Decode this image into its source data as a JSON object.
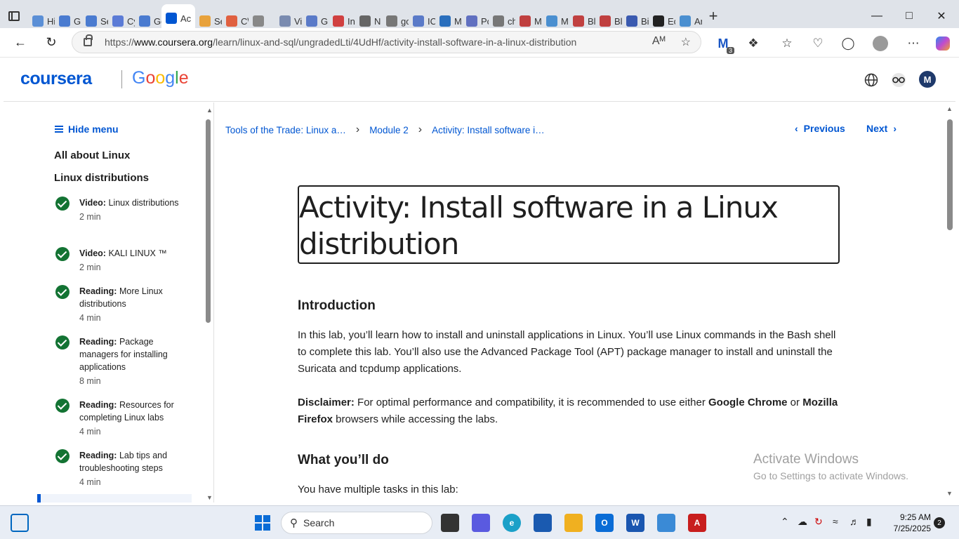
{
  "browser": {
    "tabs": [
      {
        "label": "Hi",
        "color": "#5b8fd6"
      },
      {
        "label": "G",
        "color": "#4a7bd0"
      },
      {
        "label": "Se",
        "color": "#4a7bd0"
      },
      {
        "label": "Cy",
        "color": "#5b7bd6"
      },
      {
        "label": "Ge",
        "color": "#4a7bd0"
      },
      {
        "label": "Ac",
        "color": "#0056d2",
        "active": true
      },
      {
        "label": "Se",
        "color": "#e8a23c"
      },
      {
        "label": "C\\",
        "color": "#e06040"
      },
      {
        "label": "",
        "color": "#888888"
      },
      {
        "label": "Vi",
        "color": "#7a8bb0"
      },
      {
        "label": "Gi",
        "color": "#5a7ac8"
      },
      {
        "label": "In",
        "color": "#d04040"
      },
      {
        "label": "N",
        "color": "#666666"
      },
      {
        "label": "go",
        "color": "#777777"
      },
      {
        "label": "IC",
        "color": "#5a7ac8"
      },
      {
        "label": "M",
        "color": "#2a6fbd"
      },
      {
        "label": "Pc",
        "color": "#6070c0"
      },
      {
        "label": "ch",
        "color": "#777777"
      },
      {
        "label": "M",
        "color": "#c04040"
      },
      {
        "label": "M",
        "color": "#4a8fd0"
      },
      {
        "label": "Bl",
        "color": "#c04040"
      },
      {
        "label": "Bl",
        "color": "#c04040"
      },
      {
        "label": "Bi",
        "color": "#3a5ab0"
      },
      {
        "label": "Ec",
        "color": "#222222"
      },
      {
        "label": "Ar",
        "color": "#4a8fd0"
      }
    ],
    "url_prefix": "https://",
    "url_domain": "www.coursera.org",
    "url_path": "/learn/linux-and-sql/ungradedLti/4UdHf/activity-install-software-in-a-linux-distribution",
    "extension_badge": "3"
  },
  "header": {
    "logo_coursera": "coursera",
    "logo_google": [
      "G",
      "o",
      "o",
      "g",
      "l",
      "e"
    ],
    "avatar_initial": "M"
  },
  "sidebar": {
    "hide_menu": "Hide menu",
    "section_1": "All about Linux",
    "section_2": "Linux distributions",
    "items": [
      {
        "kind": "Video:",
        "title": "Linux distributions",
        "duration": "2 min"
      },
      {
        "kind": "Video:",
        "title": "KALI LINUX ™",
        "duration": "2 min"
      },
      {
        "kind": "Reading:",
        "title": "More Linux distributions",
        "duration": "4 min"
      },
      {
        "kind": "Reading:",
        "title": "Package managers for installing applications",
        "duration": "8 min"
      },
      {
        "kind": "Reading:",
        "title": "Resources for completing Linux labs",
        "duration": "4 min"
      },
      {
        "kind": "Reading:",
        "title": "Lab tips and troubleshooting steps",
        "duration": "4 min"
      }
    ]
  },
  "breadcrumb": {
    "course": "Tools of the Trade: Linux a…",
    "module": "Module 2",
    "page": "Activity: Install software i…"
  },
  "pager": {
    "previous": "Previous",
    "next": "Next"
  },
  "content": {
    "title": "Activity: Install software in a Linux distribution",
    "intro_heading": "Introduction",
    "intro_text": "In this lab, you’ll learn how to install and uninstall applications in Linux. You’ll use Linux commands in the Bash shell to complete this lab. You’ll also use the Advanced Package Tool (APT) package manager to install and uninstall the Suricata and tcpdump applications.",
    "disclaimer_label": "Disclaimer:",
    "disclaimer_text_1": " For optimal performance and compatibility, it is recommended to use either ",
    "disclaimer_chrome": "Google Chrome",
    "disclaimer_text_2": " or ",
    "disclaimer_firefox": "Mozilla Firefox",
    "disclaimer_text_3": " browsers while accessing the labs.",
    "todo_heading": "What you’ll do",
    "todo_text": "You have multiple tasks in this lab:"
  },
  "watermark": {
    "line1": "Activate Windows",
    "line2": "Go to Settings to activate Windows."
  },
  "taskbar": {
    "search_placeholder": "Search",
    "time": "9:25 AM",
    "date": "7/25/2025",
    "notifications": "2"
  }
}
